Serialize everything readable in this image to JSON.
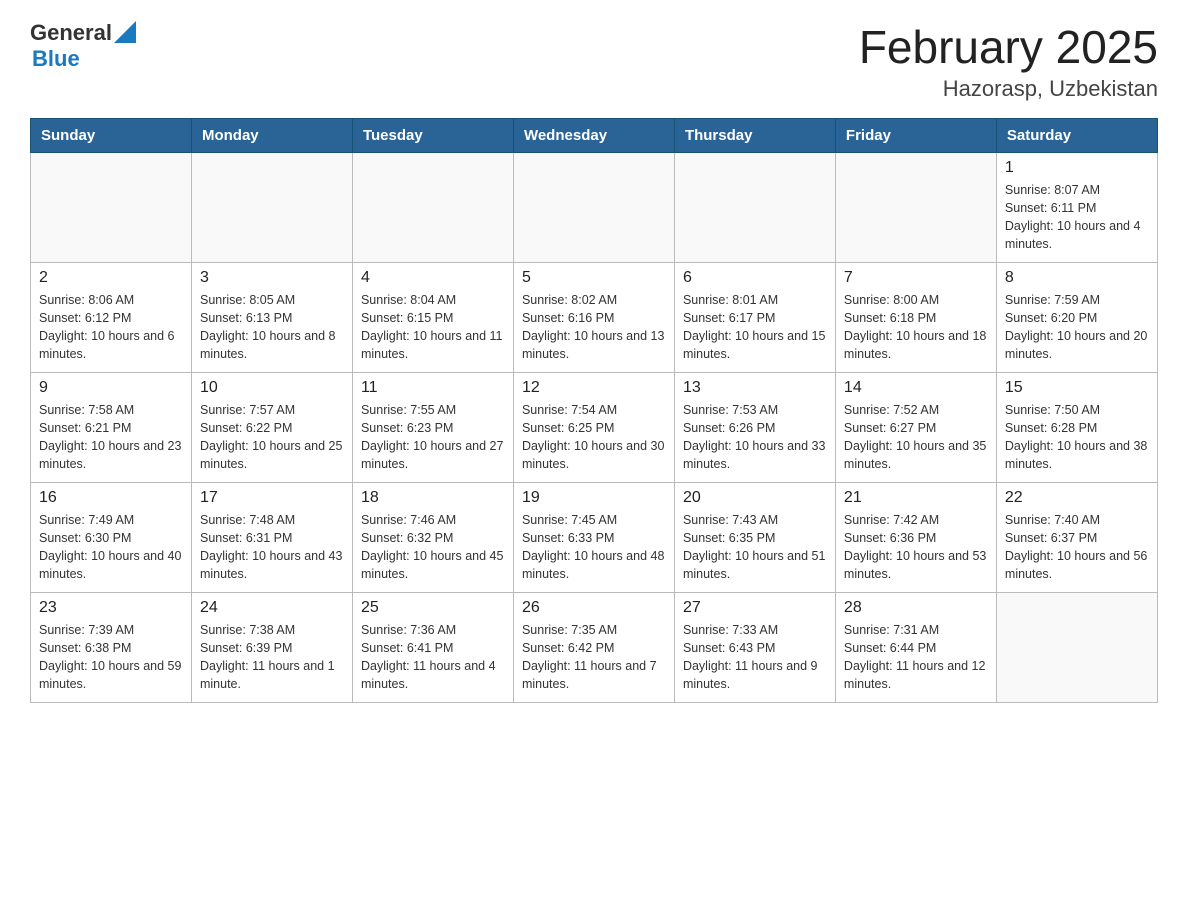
{
  "header": {
    "logo_general": "General",
    "logo_blue": "Blue",
    "month_title": "February 2025",
    "location": "Hazorasp, Uzbekistan"
  },
  "weekdays": [
    "Sunday",
    "Monday",
    "Tuesday",
    "Wednesday",
    "Thursday",
    "Friday",
    "Saturday"
  ],
  "weeks": [
    [
      {
        "day": "",
        "info": ""
      },
      {
        "day": "",
        "info": ""
      },
      {
        "day": "",
        "info": ""
      },
      {
        "day": "",
        "info": ""
      },
      {
        "day": "",
        "info": ""
      },
      {
        "day": "",
        "info": ""
      },
      {
        "day": "1",
        "info": "Sunrise: 8:07 AM\nSunset: 6:11 PM\nDaylight: 10 hours and 4 minutes."
      }
    ],
    [
      {
        "day": "2",
        "info": "Sunrise: 8:06 AM\nSunset: 6:12 PM\nDaylight: 10 hours and 6 minutes."
      },
      {
        "day": "3",
        "info": "Sunrise: 8:05 AM\nSunset: 6:13 PM\nDaylight: 10 hours and 8 minutes."
      },
      {
        "day": "4",
        "info": "Sunrise: 8:04 AM\nSunset: 6:15 PM\nDaylight: 10 hours and 11 minutes."
      },
      {
        "day": "5",
        "info": "Sunrise: 8:02 AM\nSunset: 6:16 PM\nDaylight: 10 hours and 13 minutes."
      },
      {
        "day": "6",
        "info": "Sunrise: 8:01 AM\nSunset: 6:17 PM\nDaylight: 10 hours and 15 minutes."
      },
      {
        "day": "7",
        "info": "Sunrise: 8:00 AM\nSunset: 6:18 PM\nDaylight: 10 hours and 18 minutes."
      },
      {
        "day": "8",
        "info": "Sunrise: 7:59 AM\nSunset: 6:20 PM\nDaylight: 10 hours and 20 minutes."
      }
    ],
    [
      {
        "day": "9",
        "info": "Sunrise: 7:58 AM\nSunset: 6:21 PM\nDaylight: 10 hours and 23 minutes."
      },
      {
        "day": "10",
        "info": "Sunrise: 7:57 AM\nSunset: 6:22 PM\nDaylight: 10 hours and 25 minutes."
      },
      {
        "day": "11",
        "info": "Sunrise: 7:55 AM\nSunset: 6:23 PM\nDaylight: 10 hours and 27 minutes."
      },
      {
        "day": "12",
        "info": "Sunrise: 7:54 AM\nSunset: 6:25 PM\nDaylight: 10 hours and 30 minutes."
      },
      {
        "day": "13",
        "info": "Sunrise: 7:53 AM\nSunset: 6:26 PM\nDaylight: 10 hours and 33 minutes."
      },
      {
        "day": "14",
        "info": "Sunrise: 7:52 AM\nSunset: 6:27 PM\nDaylight: 10 hours and 35 minutes."
      },
      {
        "day": "15",
        "info": "Sunrise: 7:50 AM\nSunset: 6:28 PM\nDaylight: 10 hours and 38 minutes."
      }
    ],
    [
      {
        "day": "16",
        "info": "Sunrise: 7:49 AM\nSunset: 6:30 PM\nDaylight: 10 hours and 40 minutes."
      },
      {
        "day": "17",
        "info": "Sunrise: 7:48 AM\nSunset: 6:31 PM\nDaylight: 10 hours and 43 minutes."
      },
      {
        "day": "18",
        "info": "Sunrise: 7:46 AM\nSunset: 6:32 PM\nDaylight: 10 hours and 45 minutes."
      },
      {
        "day": "19",
        "info": "Sunrise: 7:45 AM\nSunset: 6:33 PM\nDaylight: 10 hours and 48 minutes."
      },
      {
        "day": "20",
        "info": "Sunrise: 7:43 AM\nSunset: 6:35 PM\nDaylight: 10 hours and 51 minutes."
      },
      {
        "day": "21",
        "info": "Sunrise: 7:42 AM\nSunset: 6:36 PM\nDaylight: 10 hours and 53 minutes."
      },
      {
        "day": "22",
        "info": "Sunrise: 7:40 AM\nSunset: 6:37 PM\nDaylight: 10 hours and 56 minutes."
      }
    ],
    [
      {
        "day": "23",
        "info": "Sunrise: 7:39 AM\nSunset: 6:38 PM\nDaylight: 10 hours and 59 minutes."
      },
      {
        "day": "24",
        "info": "Sunrise: 7:38 AM\nSunset: 6:39 PM\nDaylight: 11 hours and 1 minute."
      },
      {
        "day": "25",
        "info": "Sunrise: 7:36 AM\nSunset: 6:41 PM\nDaylight: 11 hours and 4 minutes."
      },
      {
        "day": "26",
        "info": "Sunrise: 7:35 AM\nSunset: 6:42 PM\nDaylight: 11 hours and 7 minutes."
      },
      {
        "day": "27",
        "info": "Sunrise: 7:33 AM\nSunset: 6:43 PM\nDaylight: 11 hours and 9 minutes."
      },
      {
        "day": "28",
        "info": "Sunrise: 7:31 AM\nSunset: 6:44 PM\nDaylight: 11 hours and 12 minutes."
      },
      {
        "day": "",
        "info": ""
      }
    ]
  ]
}
